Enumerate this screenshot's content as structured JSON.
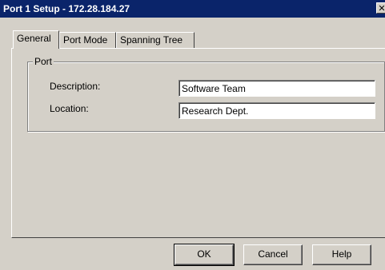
{
  "window": {
    "title": "Port 1 Setup - 172.28.184.27"
  },
  "tabs": [
    {
      "label": "General",
      "active": true
    },
    {
      "label": "Port Mode",
      "active": false
    },
    {
      "label": "Spanning Tree",
      "active": false
    }
  ],
  "port_group": {
    "label": "Port",
    "description_label": "Description:",
    "description_value": "Software Team",
    "location_label": "Location:",
    "location_value": "Research Dept."
  },
  "buttons": {
    "ok": "OK",
    "cancel": "Cancel",
    "help": "Help"
  },
  "icons": {
    "close": "close-icon"
  },
  "colors": {
    "titlebar": "#0a246a",
    "dialog": "#d4d0c8"
  }
}
